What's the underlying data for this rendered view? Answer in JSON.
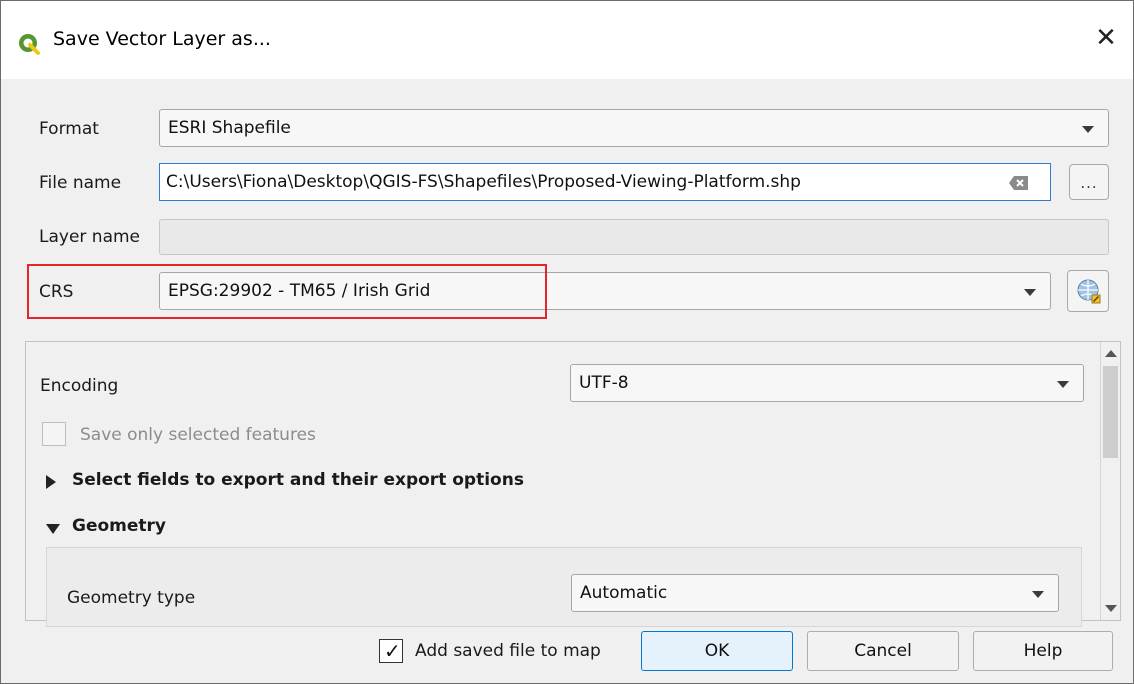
{
  "window": {
    "title": "Save Vector Layer as..."
  },
  "form": {
    "format_label": "Format",
    "format_value": "ESRI Shapefile",
    "file_name_label": "File name",
    "file_name_value": "C:\\Users\\Fiona\\Desktop\\QGIS-FS\\Shapefiles\\Proposed-Viewing-Platform.shp",
    "browse_label": "...",
    "layer_name_label": "Layer name",
    "layer_name_value": "",
    "crs_label": "CRS",
    "crs_value": "EPSG:29902 - TM65 / Irish Grid"
  },
  "options": {
    "encoding_label": "Encoding",
    "encoding_value": "UTF-8",
    "save_selected_label": "Save only selected features",
    "save_selected_checked": false,
    "select_fields_label": "Select fields to export and their export options",
    "geometry_label": "Geometry",
    "geometry_type_label": "Geometry type",
    "geometry_type_value": "Automatic"
  },
  "footer": {
    "add_to_map_label": "Add saved file to map",
    "add_to_map_checked": true,
    "ok_label": "OK",
    "cancel_label": "Cancel",
    "help_label": "Help"
  },
  "colors": {
    "highlight_box": "#e3262c",
    "qgis_green": "#589632",
    "focus_border": "#2f7bd3"
  },
  "icons": [
    "qgis-logo-icon",
    "close-icon",
    "clear-text-icon",
    "crs-globe-icon",
    "chevron-down-icon",
    "expand-triangle-icon",
    "collapse-triangle-icon",
    "checkmark-icon"
  ]
}
